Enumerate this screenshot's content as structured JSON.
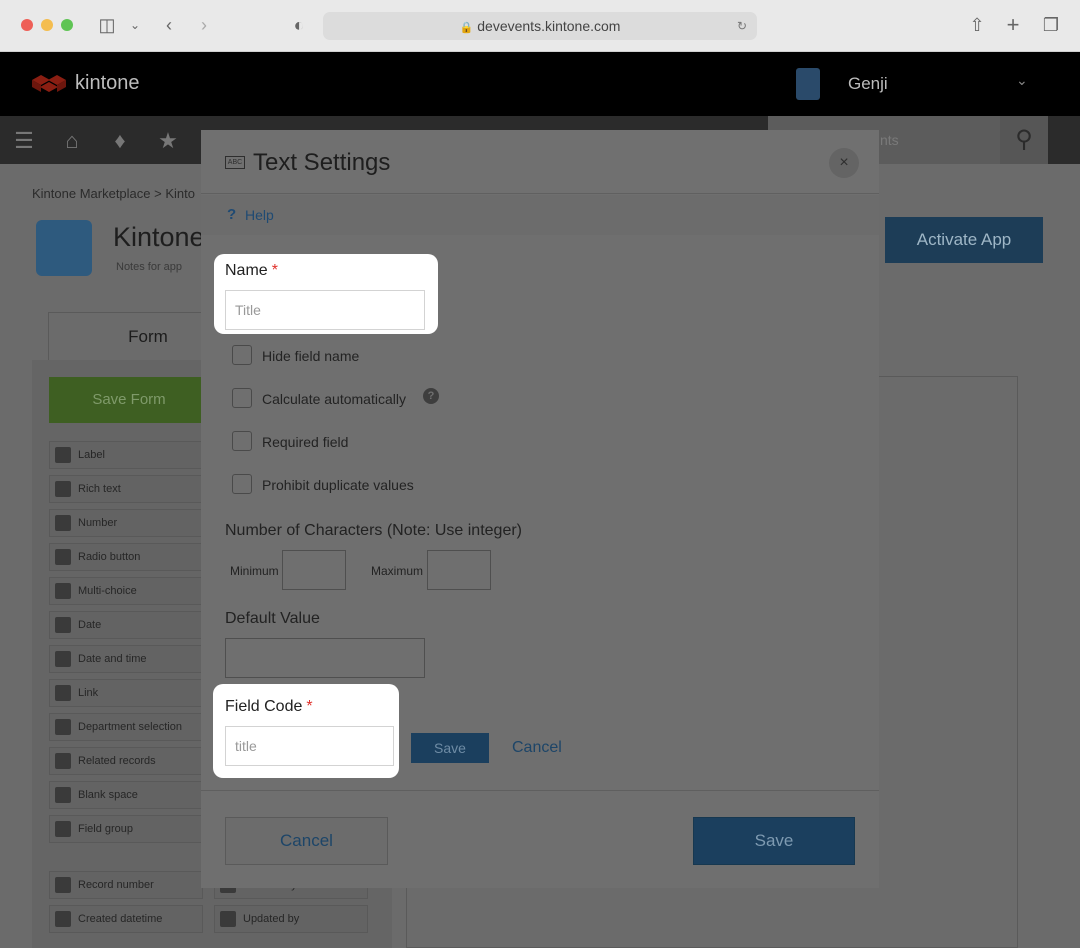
{
  "browser": {
    "url": "devevents.kintone.com"
  },
  "header": {
    "brand": "kintone",
    "user_name": "Genji",
    "search_placeholder": "nts"
  },
  "page": {
    "breadcrumb": "Kintone Marketplace  >  Kinto",
    "app_title": "Kintone",
    "app_notes": "Notes for app",
    "activate_label": "Activate App",
    "form_tab": "Form",
    "save_form_label": "Save Form",
    "fields": [
      "Label",
      "Rich text",
      "Number",
      "Radio button",
      "Multi-choice",
      "Date",
      "Date and time",
      "Link",
      "Department selection",
      "Related records",
      "Blank space",
      "Field group"
    ],
    "system_fields_left": [
      "Record number",
      "Created datetime"
    ],
    "system_fields_right": [
      "Created by",
      "Updated by"
    ]
  },
  "modal": {
    "title_icon_text": "ABC",
    "title": "Text Settings",
    "close_glyph": "×",
    "help": "Help",
    "name_label": "Name",
    "required_mark": "*",
    "name_placeholder": "Title",
    "checkboxes": [
      "Hide field name",
      "Calculate automatically",
      "Required field",
      "Prohibit duplicate values"
    ],
    "num_chars_label": "Number of Characters (Note: Use integer)",
    "minimum_label": "Minimum",
    "maximum_label": "Maximum",
    "default_value_label": "Default Value",
    "field_code_label": "Field Code",
    "field_code_placeholder": "title",
    "inline_save": "Save",
    "inline_cancel": "Cancel",
    "footer_cancel": "Cancel",
    "footer_save": "Save"
  }
}
